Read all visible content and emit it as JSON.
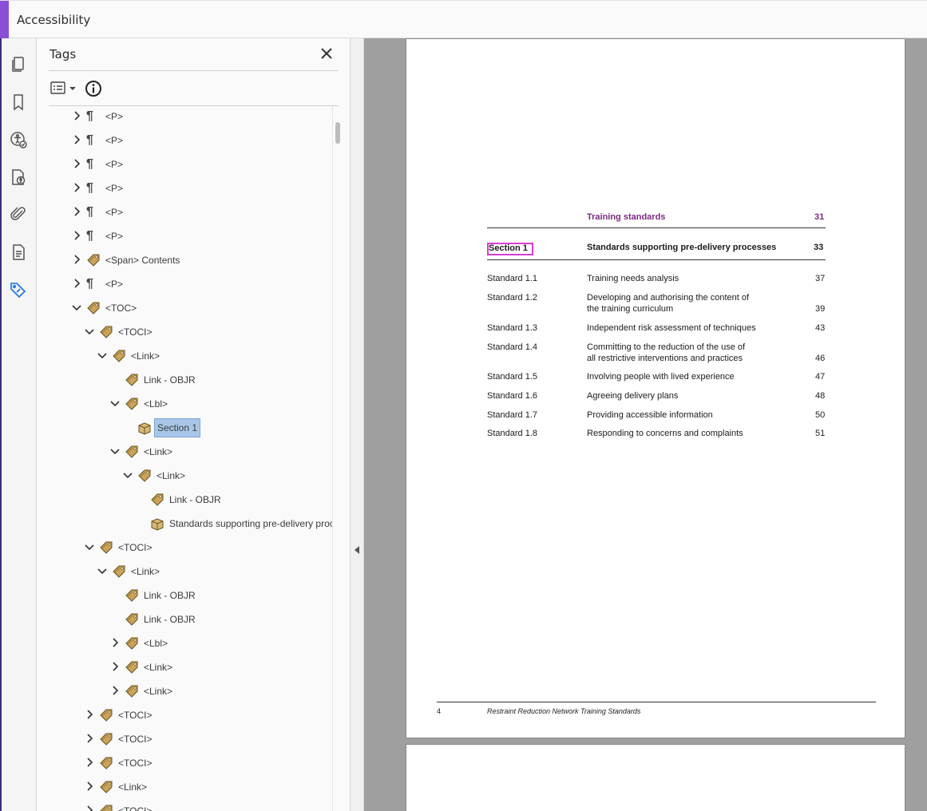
{
  "app": {
    "title": "Accessibility"
  },
  "rail": {
    "icons": [
      "pages-icon",
      "bookmark-icon",
      "accessibility-check-icon",
      "accessibility-doc-icon",
      "attachment-icon",
      "content-icon",
      "tags-icon"
    ]
  },
  "panel": {
    "title": "Tags",
    "close_icon": "close-icon",
    "options_icon": "options-list-icon",
    "info_icon": "info-icon"
  },
  "tree": {
    "rows": [
      {
        "label": "<P>",
        "type": "p",
        "depth": 0,
        "state": "collapsed"
      },
      {
        "label": "<P>",
        "type": "p",
        "depth": 0,
        "state": "collapsed"
      },
      {
        "label": "<P>",
        "type": "p",
        "depth": 0,
        "state": "collapsed"
      },
      {
        "label": "<P>",
        "type": "p",
        "depth": 0,
        "state": "collapsed"
      },
      {
        "label": "<P>",
        "type": "p",
        "depth": 0,
        "state": "collapsed"
      },
      {
        "label": "<P>",
        "type": "p",
        "depth": 0,
        "state": "collapsed"
      },
      {
        "label": "<Span> Contents",
        "type": "tag",
        "depth": 0,
        "state": "collapsed"
      },
      {
        "label": "<P>",
        "type": "p",
        "depth": 0,
        "state": "collapsed"
      },
      {
        "label": "<TOC>",
        "type": "tag",
        "depth": 0,
        "state": "expanded"
      },
      {
        "label": "<TOCI>",
        "type": "tag",
        "depth": 1,
        "state": "expanded"
      },
      {
        "label": "<Link>",
        "type": "tag",
        "depth": 2,
        "state": "expanded"
      },
      {
        "label": "Link - OBJR",
        "type": "tag",
        "depth": 3,
        "state": "leaf"
      },
      {
        "label": "<Lbl>",
        "type": "tag",
        "depth": 3,
        "state": "expanded"
      },
      {
        "label": "Section 1",
        "type": "box",
        "depth": 4,
        "state": "leaf",
        "selected": true
      },
      {
        "label": "<Link>",
        "type": "tag",
        "depth": 3,
        "state": "expanded"
      },
      {
        "label": "<Link>",
        "type": "tag",
        "depth": 4,
        "state": "expanded"
      },
      {
        "label": "Link - OBJR",
        "type": "tag",
        "depth": 5,
        "state": "leaf"
      },
      {
        "label": "Standards supporting pre-delivery process",
        "type": "box",
        "depth": 5,
        "state": "leaf"
      },
      {
        "label": "<TOCI>",
        "type": "tag",
        "depth": 1,
        "state": "expanded"
      },
      {
        "label": "<Link>",
        "type": "tag",
        "depth": 2,
        "state": "expanded"
      },
      {
        "label": "Link - OBJR",
        "type": "tag",
        "depth": 3,
        "state": "leaf"
      },
      {
        "label": "Link - OBJR",
        "type": "tag",
        "depth": 3,
        "state": "leaf"
      },
      {
        "label": "<Lbl>",
        "type": "tag",
        "depth": 3,
        "state": "collapsed"
      },
      {
        "label": "<Link>",
        "type": "tag",
        "depth": 3,
        "state": "collapsed"
      },
      {
        "label": "<Link>",
        "type": "tag",
        "depth": 3,
        "state": "collapsed"
      },
      {
        "label": "<TOCI>",
        "type": "tag",
        "depth": 1,
        "state": "collapsed"
      },
      {
        "label": "<TOCI>",
        "type": "tag",
        "depth": 1,
        "state": "collapsed"
      },
      {
        "label": "<TOCI>",
        "type": "tag",
        "depth": 1,
        "state": "collapsed"
      },
      {
        "label": "<Link>",
        "type": "tag",
        "depth": 1,
        "state": "collapsed"
      },
      {
        "label": "<TOCI>",
        "type": "tag",
        "depth": 1,
        "state": "collapsed"
      }
    ]
  },
  "document": {
    "heading": {
      "title": "Training standards",
      "page": "31"
    },
    "section": {
      "label": "Section 1",
      "title": "Standards supporting pre-delivery processes",
      "page": "33"
    },
    "entries": [
      {
        "num": "Standard 1.1",
        "line1": "Training needs analysis",
        "line2": "",
        "page": "37"
      },
      {
        "num": "Standard 1.2",
        "line1": "Developing and authorising the content of",
        "line2": "the training curriculum",
        "page": "39"
      },
      {
        "num": "Standard 1.3",
        "line1": "Independent risk assessment of techniques",
        "line2": "",
        "page": "43"
      },
      {
        "num": "Standard 1.4",
        "line1": "Committing to the reduction of the use of",
        "line2": "all restrictive interventions and practices",
        "page": "46"
      },
      {
        "num": "Standard 1.5",
        "line1": "Involving people with lived experience",
        "line2": "",
        "page": "47"
      },
      {
        "num": "Standard 1.6",
        "line1": "Agreeing delivery plans",
        "line2": "",
        "page": "48"
      },
      {
        "num": "Standard 1.7",
        "line1": "Providing accessible information",
        "line2": "",
        "page": "50"
      },
      {
        "num": "Standard 1.8",
        "line1": "Responding to concerns and complaints",
        "line2": "",
        "page": "51"
      }
    ],
    "footer": {
      "page_number": "4",
      "text": "Restraint Reduction Network Training Standards"
    }
  }
}
